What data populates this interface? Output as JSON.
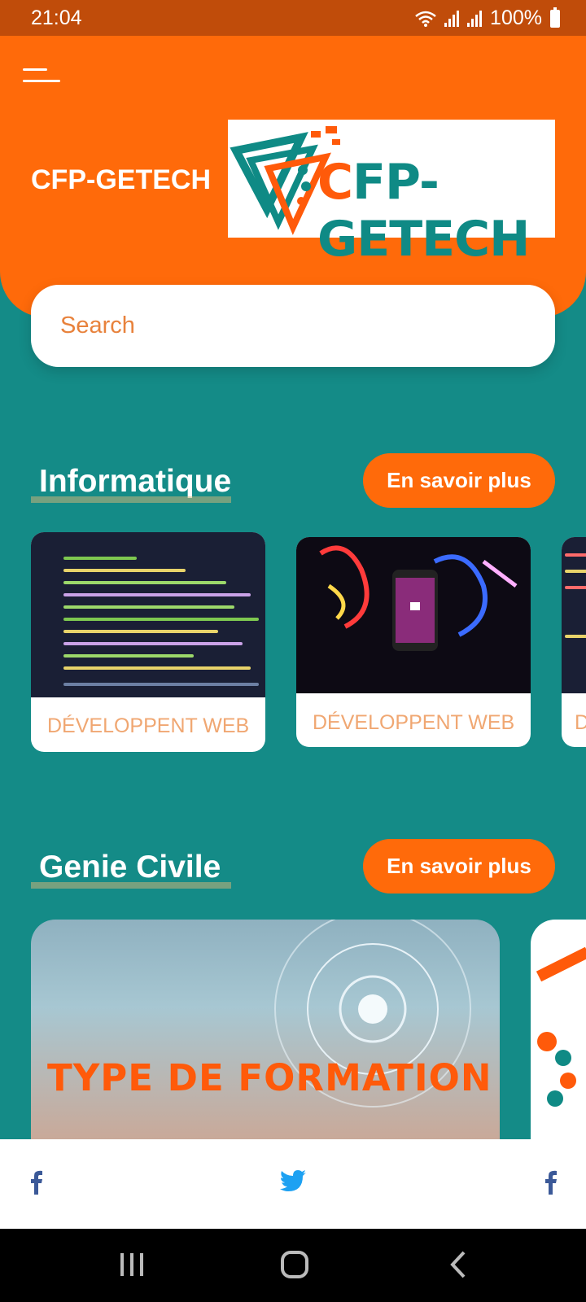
{
  "status_bar": {
    "time": "21:04",
    "battery": "100%"
  },
  "header": {
    "brand_title": "CFP-GETECH",
    "logo_text_accent": "C",
    "logo_text": "FP-GETECH"
  },
  "search": {
    "placeholder": "Search"
  },
  "sections": [
    {
      "title": "Informatique",
      "button_label": "En savoir plus",
      "cards": [
        {
          "label": "DÉVELOPPENT WEB"
        },
        {
          "label": "DÉVELOPPENT WEB"
        },
        {
          "label": "D"
        }
      ]
    },
    {
      "title": "Genie Civile",
      "button_label": "En savoir plus",
      "cards": [
        {
          "label": "TYPE DE FORMATION"
        }
      ]
    }
  ],
  "footer": {
    "icons": [
      "facebook-icon",
      "twitter-icon",
      "facebook-icon"
    ],
    "colors": {
      "facebook": "#3b5998",
      "twitter": "#1da1f2"
    }
  },
  "colors": {
    "primary_orange": "#ff6a0a",
    "teal": "#148b87"
  }
}
